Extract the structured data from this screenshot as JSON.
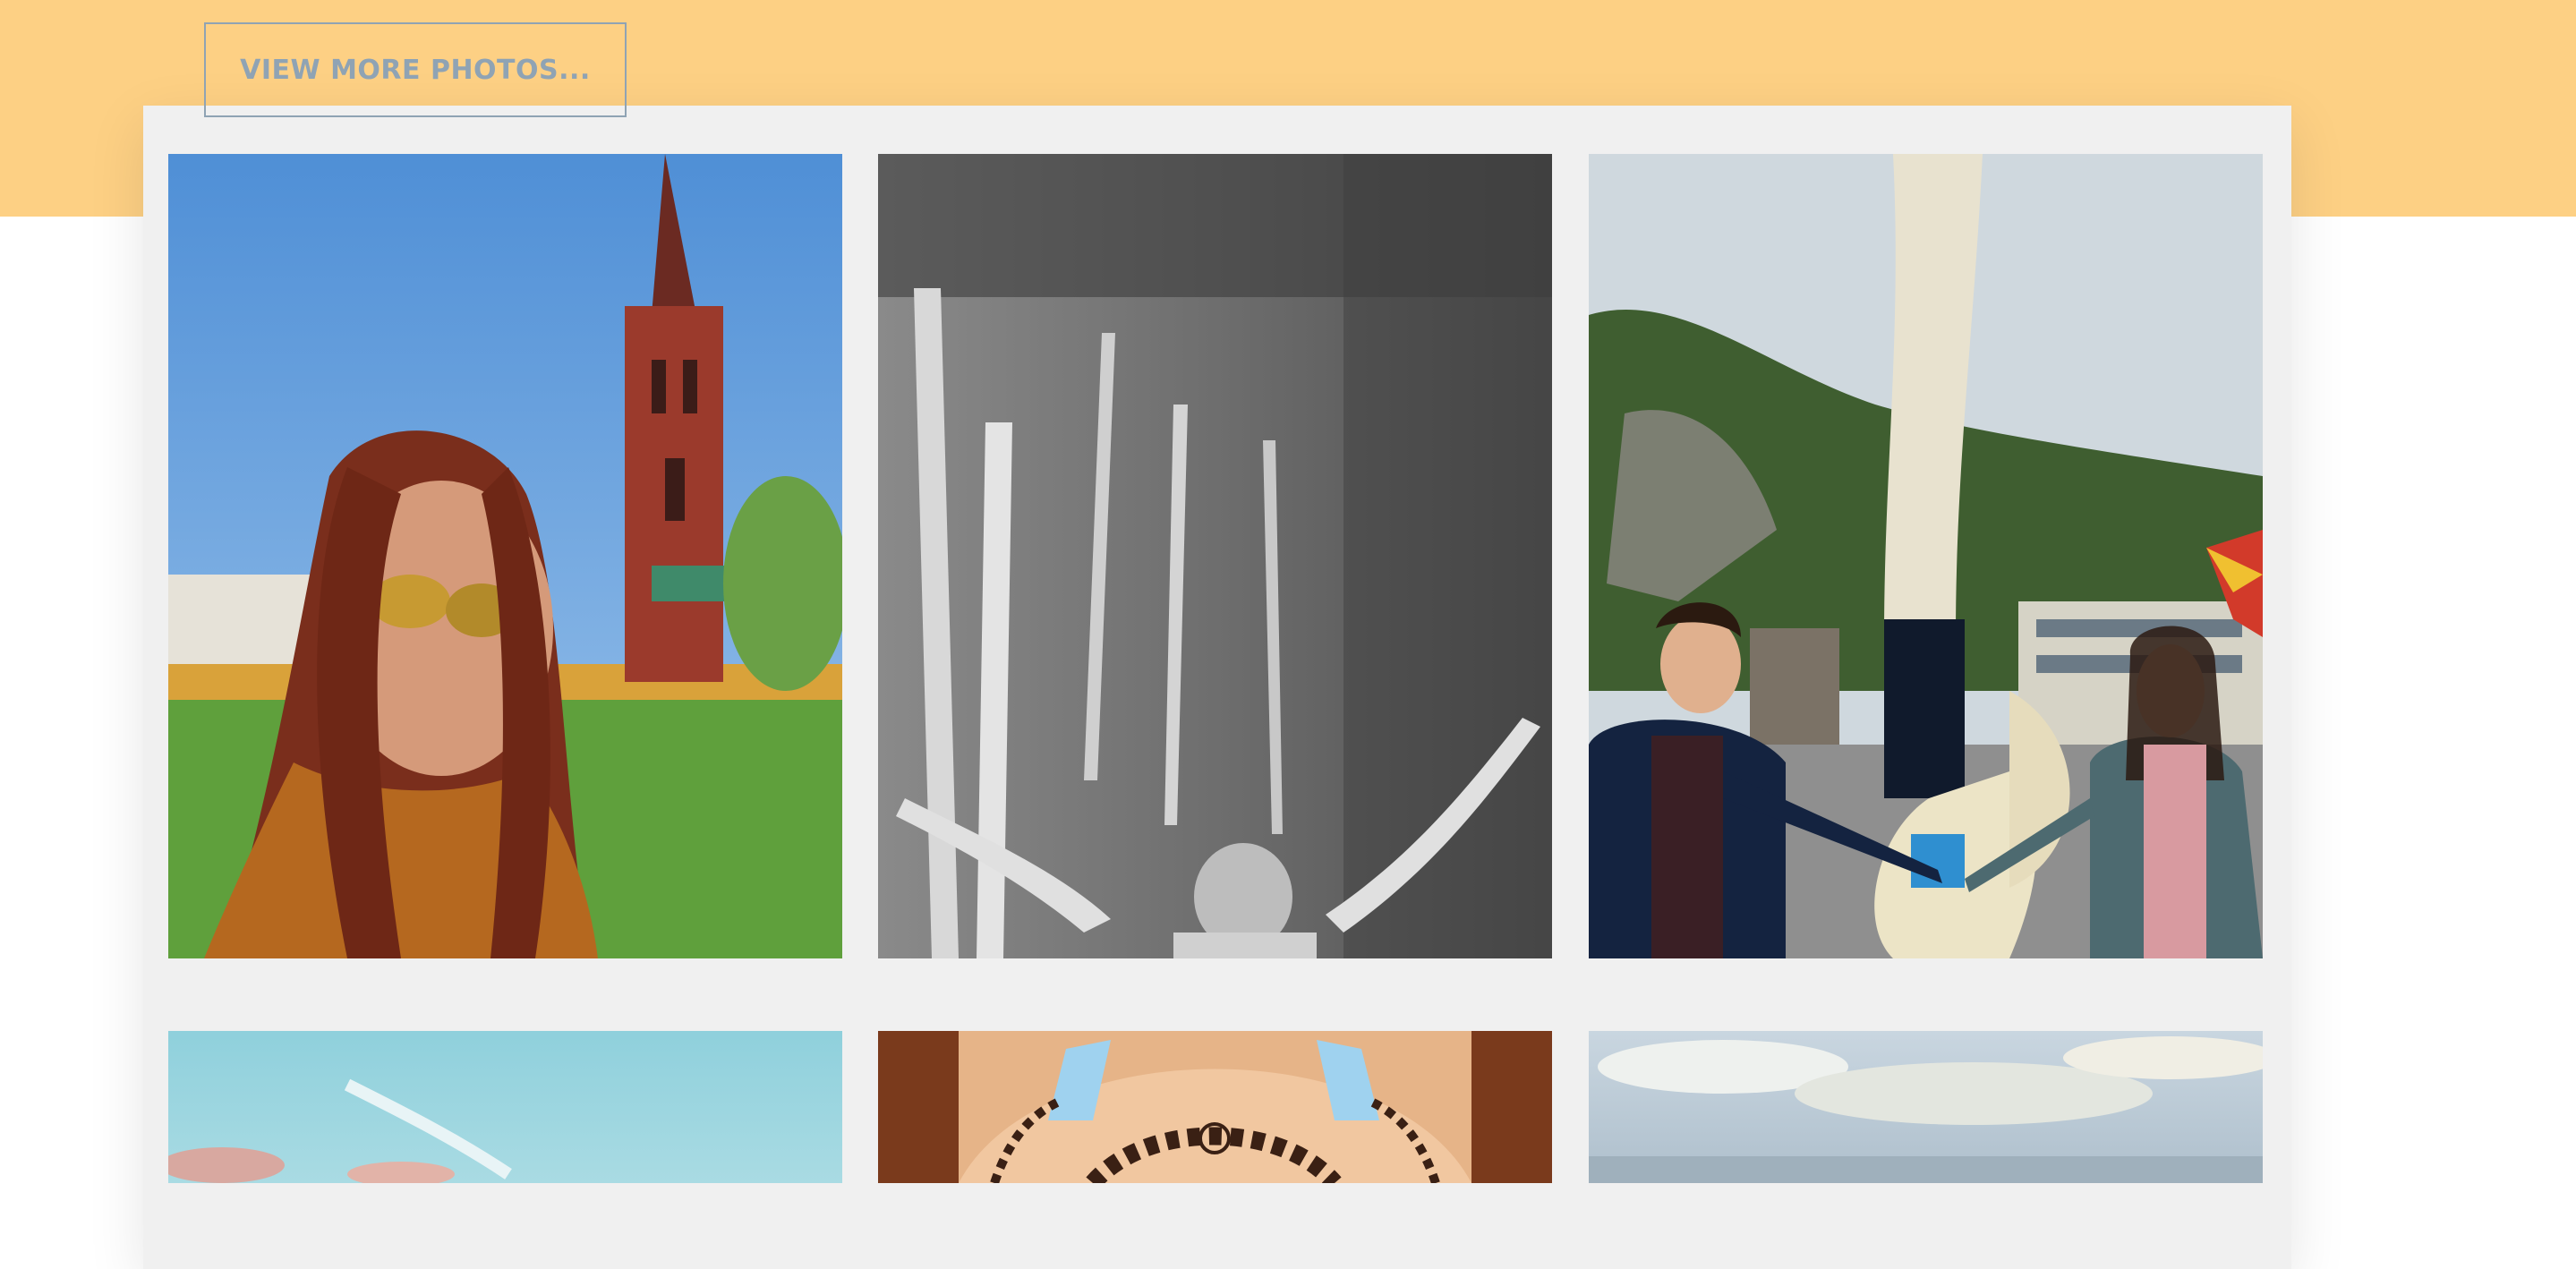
{
  "gallery": {
    "more_button_label": "VIEW MORE PHOTOS...",
    "photos": [
      {
        "subject": "woman-sunglasses-church"
      },
      {
        "subject": "waterfall-bw-arms-raised"
      },
      {
        "subject": "couple-saxophone-statue"
      },
      {
        "subject": "sky-landscape"
      },
      {
        "subject": "arched-bazaar-ceiling"
      },
      {
        "subject": "cloudy-sky-sea"
      }
    ]
  },
  "colors": {
    "accent_band": "#fdd084",
    "button_text": "#8fa3b4",
    "panel_bg": "#f0f0f0"
  }
}
